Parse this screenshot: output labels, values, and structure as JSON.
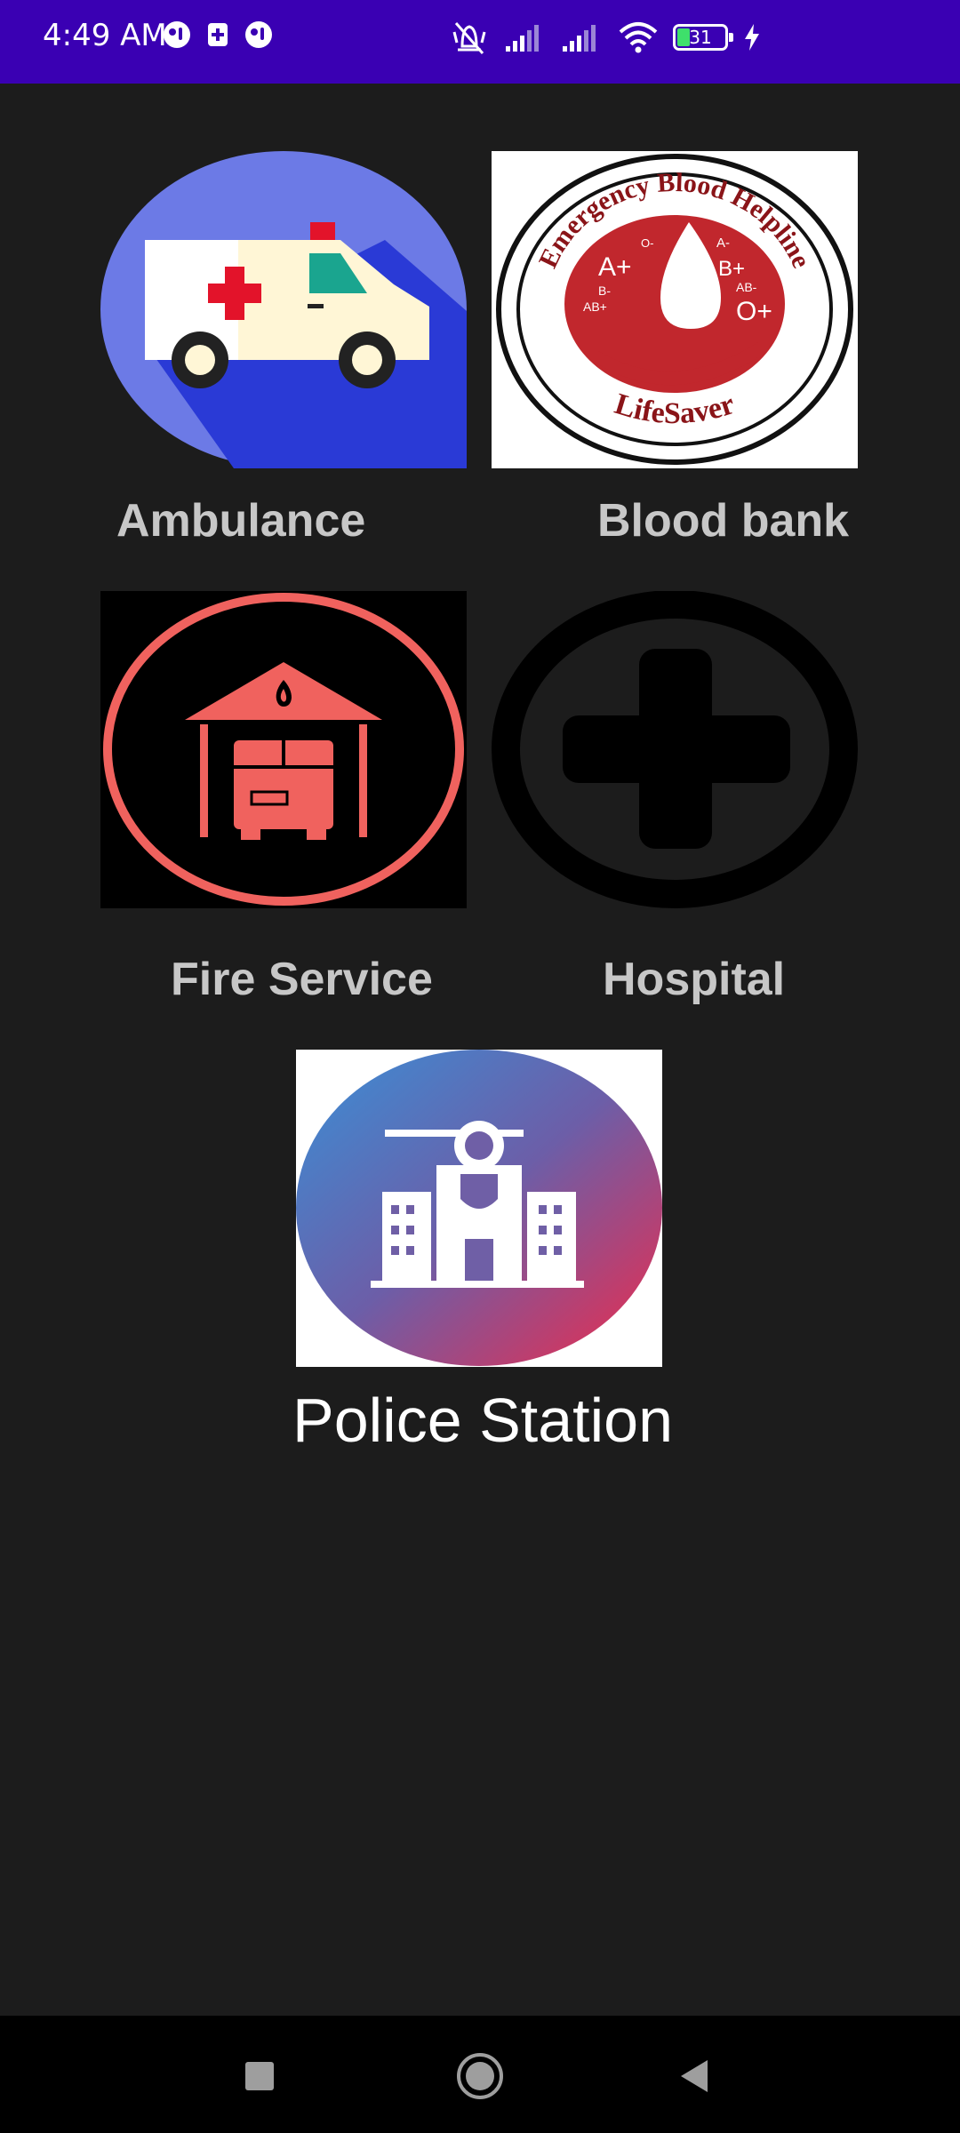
{
  "status_bar": {
    "time": "4:49 AM",
    "battery_level": "31",
    "icons": [
      "notification-icon",
      "sim-icon",
      "notification-icon",
      "mute-vibrate-icon",
      "signal-icon",
      "signal-icon",
      "wifi-icon",
      "battery-icon",
      "charging-icon"
    ]
  },
  "services": [
    {
      "label": "Ambulance",
      "icon": "ambulance-icon"
    },
    {
      "label": "Blood bank",
      "icon": "blood-bank-logo",
      "logo_text_top": "Emergency Blood Helpline",
      "logo_text_bottom": "LifeSaver",
      "blood_groups": [
        "A+",
        "O-",
        "A-",
        "B+",
        "B-",
        "AB+",
        "AB-",
        "O+"
      ]
    },
    {
      "label": "Fire Service",
      "icon": "fire-station-icon"
    },
    {
      "label": "Hospital",
      "icon": "hospital-cross-icon"
    },
    {
      "label": "Police Station",
      "icon": "police-station-icon"
    }
  ],
  "nav_bar": {
    "buttons": [
      "recents-button",
      "home-button",
      "back-button"
    ]
  },
  "colors": {
    "status_bar": "#3a00b3",
    "background": "#1c1c1c",
    "label_text": "#c7c7c7",
    "fire_red": "#f0625e",
    "blood_red": "#c1272d"
  }
}
